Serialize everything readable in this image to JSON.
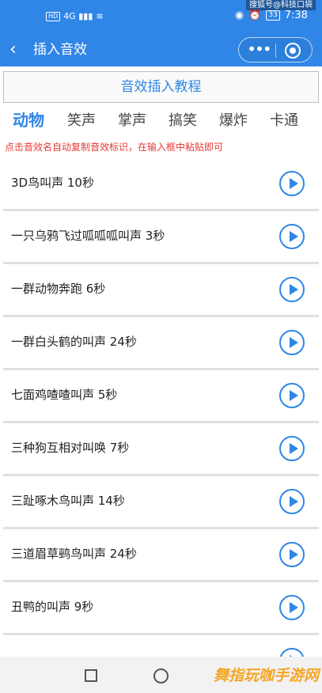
{
  "status_bar": {
    "network": "HD",
    "signal": "4G ▮▮▮",
    "wifi_icon": "wifi-icon",
    "battery": "33",
    "time": "7:38",
    "watermark": "搜狐号@科技口袋"
  },
  "navbar": {
    "title": "插入音效",
    "back_icon": "chevron-left-icon",
    "menu_icon": "more-dots-icon",
    "close_icon": "target-close-icon"
  },
  "tutorial_button": "音效插入教程",
  "tabs": [
    {
      "label": "动物",
      "active": true
    },
    {
      "label": "笑声",
      "active": false
    },
    {
      "label": "掌声",
      "active": false
    },
    {
      "label": "搞笑",
      "active": false
    },
    {
      "label": "爆炸",
      "active": false
    },
    {
      "label": "卡通",
      "active": false
    }
  ],
  "hint": "点击音效名自动复制音效标识，在输入框中粘贴即可",
  "sounds": [
    {
      "title": "3D鸟叫声 10秒"
    },
    {
      "title": "一只乌鸦飞过呱呱呱叫声 3秒"
    },
    {
      "title": "一群动物奔跑 6秒"
    },
    {
      "title": "一群白头鹤的叫声 24秒"
    },
    {
      "title": "七面鸡喳喳叫声 5秒"
    },
    {
      "title": "三种狗互相对叫唤 7秒"
    },
    {
      "title": "三趾啄木鸟叫声 14秒"
    },
    {
      "title": "三道眉草鹀鸟叫声 24秒"
    },
    {
      "title": "丑鸭的叫声 9秒"
    },
    {
      "title": ""
    }
  ],
  "bottom_watermark": "舞指玩咖手游网",
  "colors": {
    "accent": "#2f86e6",
    "hint_red": "#e53935"
  }
}
